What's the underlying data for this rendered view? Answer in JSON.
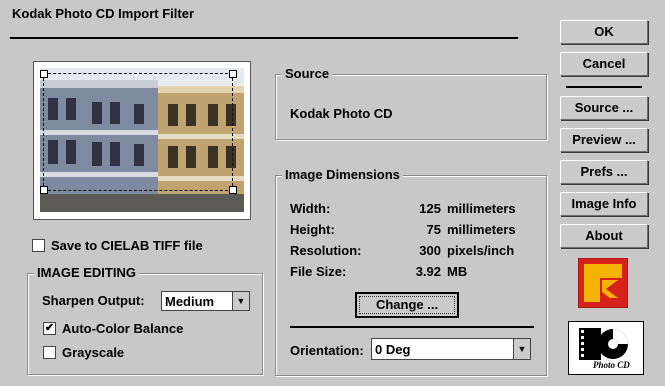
{
  "window": {
    "title": "Kodak Photo CD Import Filter"
  },
  "buttons": {
    "ok": "OK",
    "cancel": "Cancel",
    "source": "Source ...",
    "preview": "Preview ...",
    "prefs": "Prefs ...",
    "image_info": "Image Info",
    "about": "About",
    "change": "Change ..."
  },
  "source": {
    "legend": "Source",
    "value": "Kodak Photo CD"
  },
  "dimensions": {
    "legend": "Image Dimensions",
    "rows": [
      {
        "label": "Width:",
        "value": "125",
        "unit": "millimeters"
      },
      {
        "label": "Height:",
        "value": "75",
        "unit": "millimeters"
      },
      {
        "label": "Resolution:",
        "value": "300",
        "unit": "pixels/inch"
      },
      {
        "label": "File Size:",
        "value": "3.92",
        "unit": "MB"
      }
    ]
  },
  "orientation": {
    "label": "Orientation:",
    "value": "0 Deg"
  },
  "save_cielab": {
    "label": "Save to CIELAB TIFF file",
    "checked": false
  },
  "editing": {
    "legend": "IMAGE EDITING",
    "sharpen_label": "Sharpen Output:",
    "sharpen_value": "Medium",
    "auto_color": {
      "label": "Auto-Color Balance",
      "checked": true
    },
    "grayscale": {
      "label": "Grayscale",
      "checked": false
    }
  },
  "logos": {
    "photocd_text": "Photo CD"
  },
  "colors": {
    "kodak_red": "#d6221a",
    "kodak_yellow": "#f5b301",
    "background": "#c8c8c8"
  }
}
